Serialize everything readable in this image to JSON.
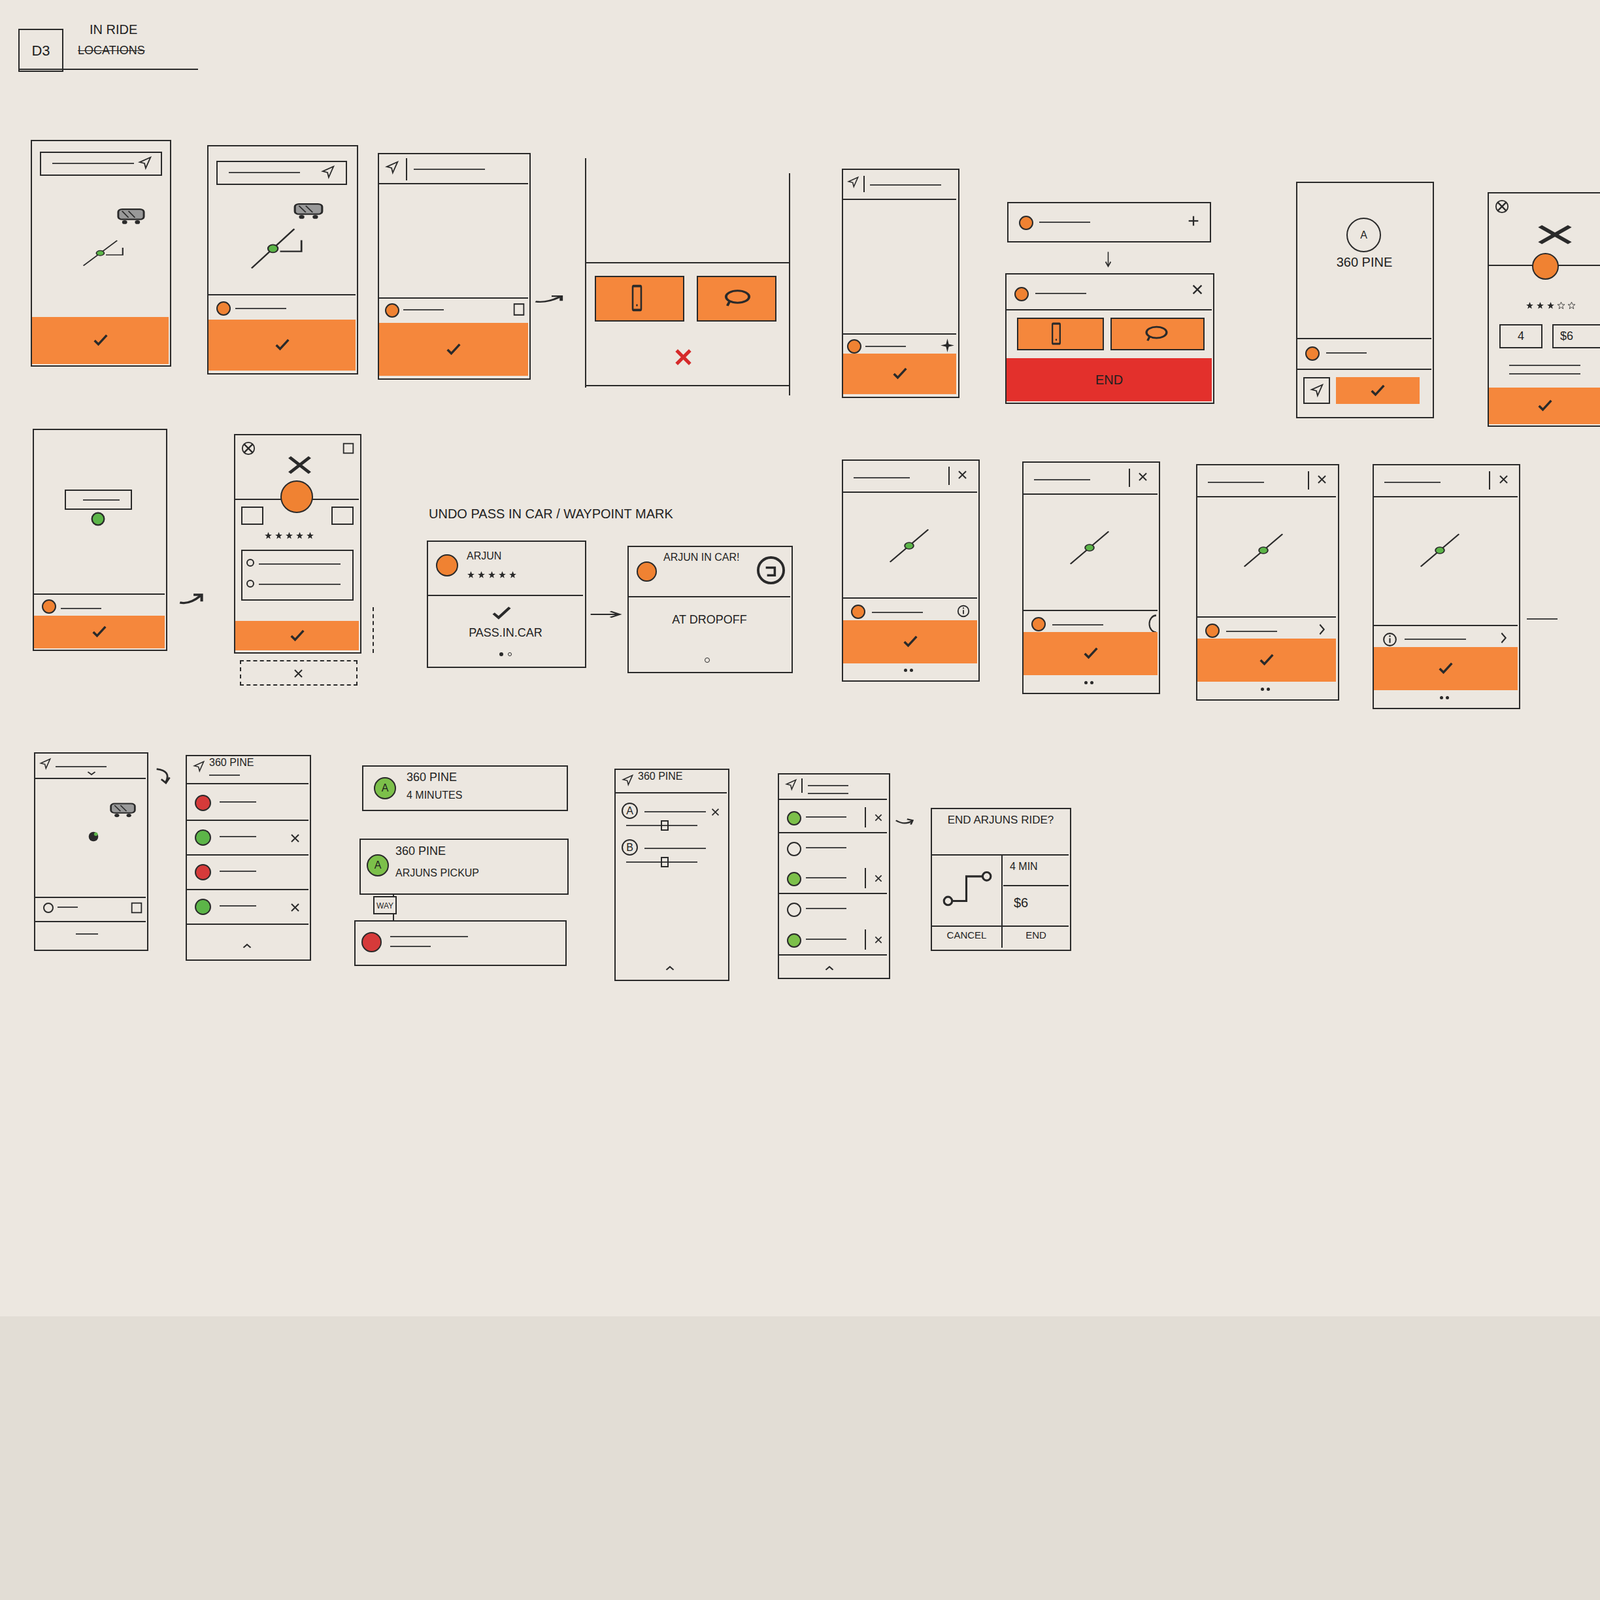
{
  "header": {
    "badge": "D3",
    "title": "IN RIDE",
    "struck": "LOCATIONS"
  },
  "end_card": {
    "button": "END"
  },
  "pickup": {
    "badge": "A",
    "address": "360 PINE"
  },
  "rider": {
    "left_box": "4",
    "right_box": "$6"
  },
  "caption": "UNDO PASS IN CAR / WAYPOINT MARK",
  "pass_card": {
    "name": "ARJUN",
    "stars": 5,
    "action": "PASS.IN.CAR"
  },
  "dropoff_card": {
    "status": "ARJUN IN CAR!",
    "action": "AT DROPOFF"
  },
  "profile": {
    "stars": 5
  },
  "stop_list": {
    "header": "360 PINE",
    "stops": [
      {
        "color": "#d63a3a",
        "removable": false
      },
      {
        "color": "#5cb548",
        "removable": true
      },
      {
        "color": "#d63a3a",
        "removable": false
      },
      {
        "color": "#5cb548",
        "removable": true
      }
    ]
  },
  "eta_card": {
    "badge": "A",
    "address": "360 PINE",
    "eta": "4 MINUTES"
  },
  "pickup_card": {
    "badge": "A",
    "address": "360 PINE",
    "label": "ARJUNS PICKUP",
    "tag": "WAY"
  },
  "waypoints": {
    "header": "360 PINE",
    "items": [
      {
        "badge": "A",
        "removable": true
      },
      {
        "badge": "B",
        "removable": false
      }
    ]
  },
  "timeline": [
    {
      "filled": true,
      "removable": true
    },
    {
      "filled": false,
      "removable": false
    },
    {
      "filled": true,
      "removable": true
    },
    {
      "filled": false,
      "removable": false
    },
    {
      "filled": true,
      "removable": true
    }
  ],
  "end_dialog": {
    "title": "END ARJUNS RIDE?",
    "eta": "4 MIN",
    "fare": "$6",
    "cancel": "CANCEL",
    "confirm": "END"
  }
}
